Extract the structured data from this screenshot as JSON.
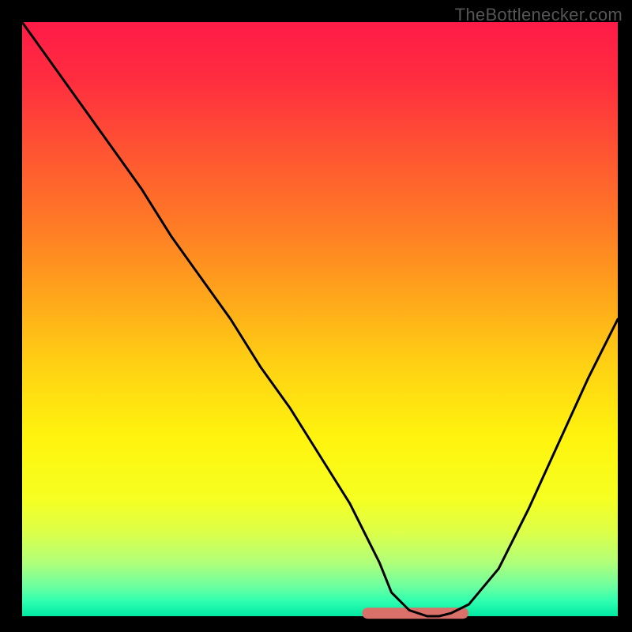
{
  "watermark": "TheBottlenecker.com",
  "colors": {
    "frame": "#000000",
    "line": "#000000",
    "marker": "#d9716a",
    "gradient_stops": [
      {
        "offset": 0.0,
        "color": "#ff1b47"
      },
      {
        "offset": 0.1,
        "color": "#ff2e3f"
      },
      {
        "offset": 0.22,
        "color": "#ff5532"
      },
      {
        "offset": 0.34,
        "color": "#ff7a26"
      },
      {
        "offset": 0.46,
        "color": "#ffa51b"
      },
      {
        "offset": 0.58,
        "color": "#ffd213"
      },
      {
        "offset": 0.7,
        "color": "#fff40e"
      },
      {
        "offset": 0.8,
        "color": "#f6ff20"
      },
      {
        "offset": 0.86,
        "color": "#dcff4a"
      },
      {
        "offset": 0.91,
        "color": "#b0ff7a"
      },
      {
        "offset": 0.95,
        "color": "#6cffa0"
      },
      {
        "offset": 0.975,
        "color": "#2effb0"
      },
      {
        "offset": 1.0,
        "color": "#00e8a3"
      }
    ]
  },
  "chart_data": {
    "type": "line",
    "title": "",
    "xlabel": "",
    "ylabel": "",
    "xlim": [
      0,
      100
    ],
    "ylim": [
      0,
      100
    ],
    "x": [
      0,
      5,
      10,
      15,
      20,
      25,
      30,
      35,
      40,
      45,
      50,
      55,
      60,
      62,
      65,
      68,
      70,
      72,
      75,
      80,
      85,
      90,
      95,
      100
    ],
    "values": [
      100,
      93,
      86,
      79,
      72,
      64,
      57,
      50,
      42,
      35,
      27,
      19,
      9,
      4,
      1,
      0,
      0,
      0.5,
      2,
      8,
      18,
      29,
      40,
      50
    ],
    "marker_range_x": [
      58,
      74
    ],
    "marker_y": 0.5,
    "note": "Values are read off the chart as percentage of vertical range (0 = bottom edge, 100 = top). Horizontal axis is normalized 0-100 across the plot width. The highlighted salmon segment sits at the bottom between roughly x=58 and x=74."
  }
}
